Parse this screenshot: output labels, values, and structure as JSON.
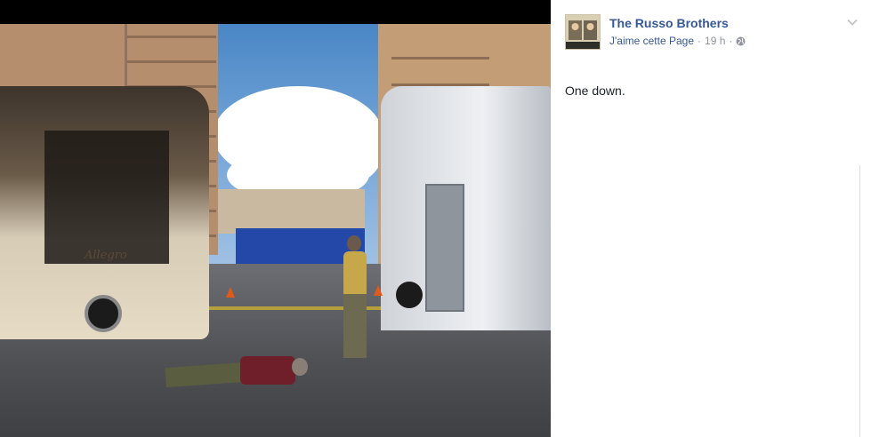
{
  "post": {
    "page_name": "The Russo Brothers",
    "like_label": "J'aime cette Page",
    "separator": "·",
    "time": "19 h",
    "audience_icon": "globe-icon",
    "menu_icon": "chevron-down-icon",
    "text": "One down."
  },
  "photo": {
    "rv_brand_text": "Allegro"
  },
  "colors": {
    "link": "#365899",
    "meta": "#90949c",
    "text": "#1d2129"
  }
}
